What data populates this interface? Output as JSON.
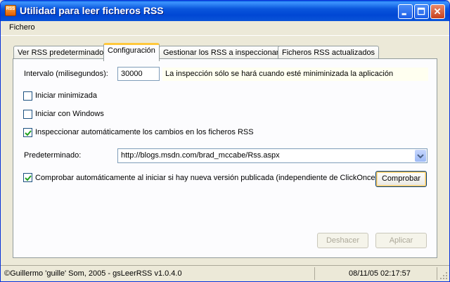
{
  "window": {
    "title": "Utilidad para leer ficheros RSS",
    "icon_text": "RSS",
    "minimize_icon": "minimize-icon",
    "maximize_icon": "maximize-icon",
    "close_icon": "close-icon"
  },
  "menu": {
    "items": [
      "Fichero"
    ]
  },
  "tabs": [
    {
      "label": "Ver RSS predeterminado",
      "active": false
    },
    {
      "label": "Configuración",
      "active": true
    },
    {
      "label": "Gestionar los RSS a inspeccionar",
      "active": false
    },
    {
      "label": "Ficheros RSS actualizados",
      "active": false
    }
  ],
  "config": {
    "interval_label": "Intervalo (milisegundos):",
    "interval_value": "30000",
    "interval_note": "La inspección sólo se hará cuando esté miniminizada la aplicación",
    "start_minimized": {
      "label": "Iniciar minimizada",
      "checked": false
    },
    "start_with_windows": {
      "label": "Iniciar con Windows",
      "checked": false
    },
    "auto_inspect": {
      "label": "Inspeccionar automáticamente los cambios en los ficheros RSS",
      "checked": true
    },
    "default_label": "Predeterminado:",
    "default_value": "http://blogs.msdn.com/brad_mccabe/Rss.aspx",
    "auto_update": {
      "label": "Comprobar automáticamente al iniciar si hay nueva versión publicada (independiente de ClickOnce)",
      "checked": true
    },
    "check_button": "Comprobar",
    "undo_button": "Deshacer",
    "apply_button": "Aplicar"
  },
  "status": {
    "copyright": "©Guillermo 'guille' Som, 2005 - gsLeerRSS v1.0.4.0",
    "datetime": "08/11/05 02:17:57"
  },
  "colors": {
    "title_bar": "#0054e3",
    "active_tab_accent": "#ffc83c",
    "window_bg": "#ece9d8"
  }
}
